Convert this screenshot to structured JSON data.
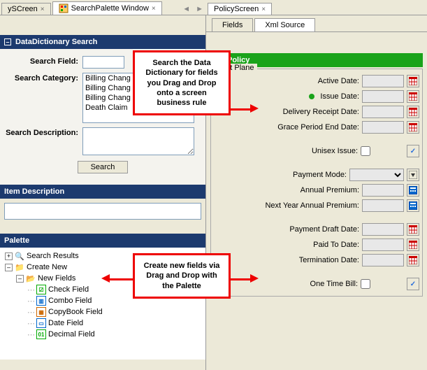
{
  "top_tabs_left": [
    {
      "label": "ySCreen",
      "active": false
    },
    {
      "label": "SearchPalette Window",
      "active": true
    }
  ],
  "top_tabs_right": [
    {
      "label": "PolicyScreen",
      "active": true
    }
  ],
  "sub_tabs": [
    {
      "label": "Fields",
      "active": false
    },
    {
      "label": "Xml Source",
      "active": true
    }
  ],
  "sections": {
    "datadict": "DataDictionary Search",
    "itemdesc": "Item Description",
    "palette": "Palette"
  },
  "form": {
    "search_field_label": "Search Field:",
    "search_category_label": "Search Category:",
    "search_description_label": "Search Description:",
    "search_button": "Search",
    "categories": [
      "Billing Chang",
      "Billing Chang",
      "Billing Chang",
      "Death Claim"
    ]
  },
  "palette_tree": {
    "search_results": "Search Results",
    "create_new": "Create New",
    "new_fields": "New Fields",
    "items": [
      {
        "label": "Check Field",
        "icon": "☑",
        "color": "#0a0"
      },
      {
        "label": "Combo Field",
        "icon": "▥",
        "color": "#06c"
      },
      {
        "label": "CopyBook Field",
        "icon": "▦",
        "color": "#c60"
      },
      {
        "label": "Date Field",
        "icon": "▭",
        "color": "#06c"
      },
      {
        "label": "Decimal Field",
        "icon": "01",
        "color": "#0a0"
      }
    ]
  },
  "policy": {
    "header": "Policy",
    "legend": "Left Plane",
    "fields": [
      {
        "label": "Active Date:",
        "type": "text",
        "icon": "cal"
      },
      {
        "label": "Issue Date:",
        "type": "text",
        "icon": "cal",
        "marker": true
      },
      {
        "label": "Delivery Receipt Date:",
        "type": "text",
        "icon": "cal"
      },
      {
        "label": "Grace Period End Date:",
        "type": "text",
        "icon": "cal"
      },
      {
        "spacer": true
      },
      {
        "label": "Unisex Issue:",
        "type": "check",
        "icon": "chk"
      },
      {
        "spacer": true
      },
      {
        "label": "Payment Mode:",
        "type": "combo",
        "icon": "combo"
      },
      {
        "label": "Annual Premium:",
        "type": "text",
        "icon": "calc"
      },
      {
        "label": "Next Year Annual Premium:",
        "type": "text",
        "icon": "calc"
      },
      {
        "spacer": true
      },
      {
        "label": "Payment Draft Date:",
        "type": "text",
        "icon": "cal"
      },
      {
        "label": "Paid To Date:",
        "type": "text",
        "icon": "cal"
      },
      {
        "label": "Termination Date:",
        "type": "text",
        "icon": "cal"
      },
      {
        "spacer": true
      },
      {
        "label": "One Time Bill:",
        "type": "check",
        "icon": "chk"
      }
    ]
  },
  "callouts": {
    "top": "Search the Data Dictionary for fields you Drag and Drop onto a screen business rule",
    "bottom": "Create new fields via Drag and Drop with the Palette"
  }
}
